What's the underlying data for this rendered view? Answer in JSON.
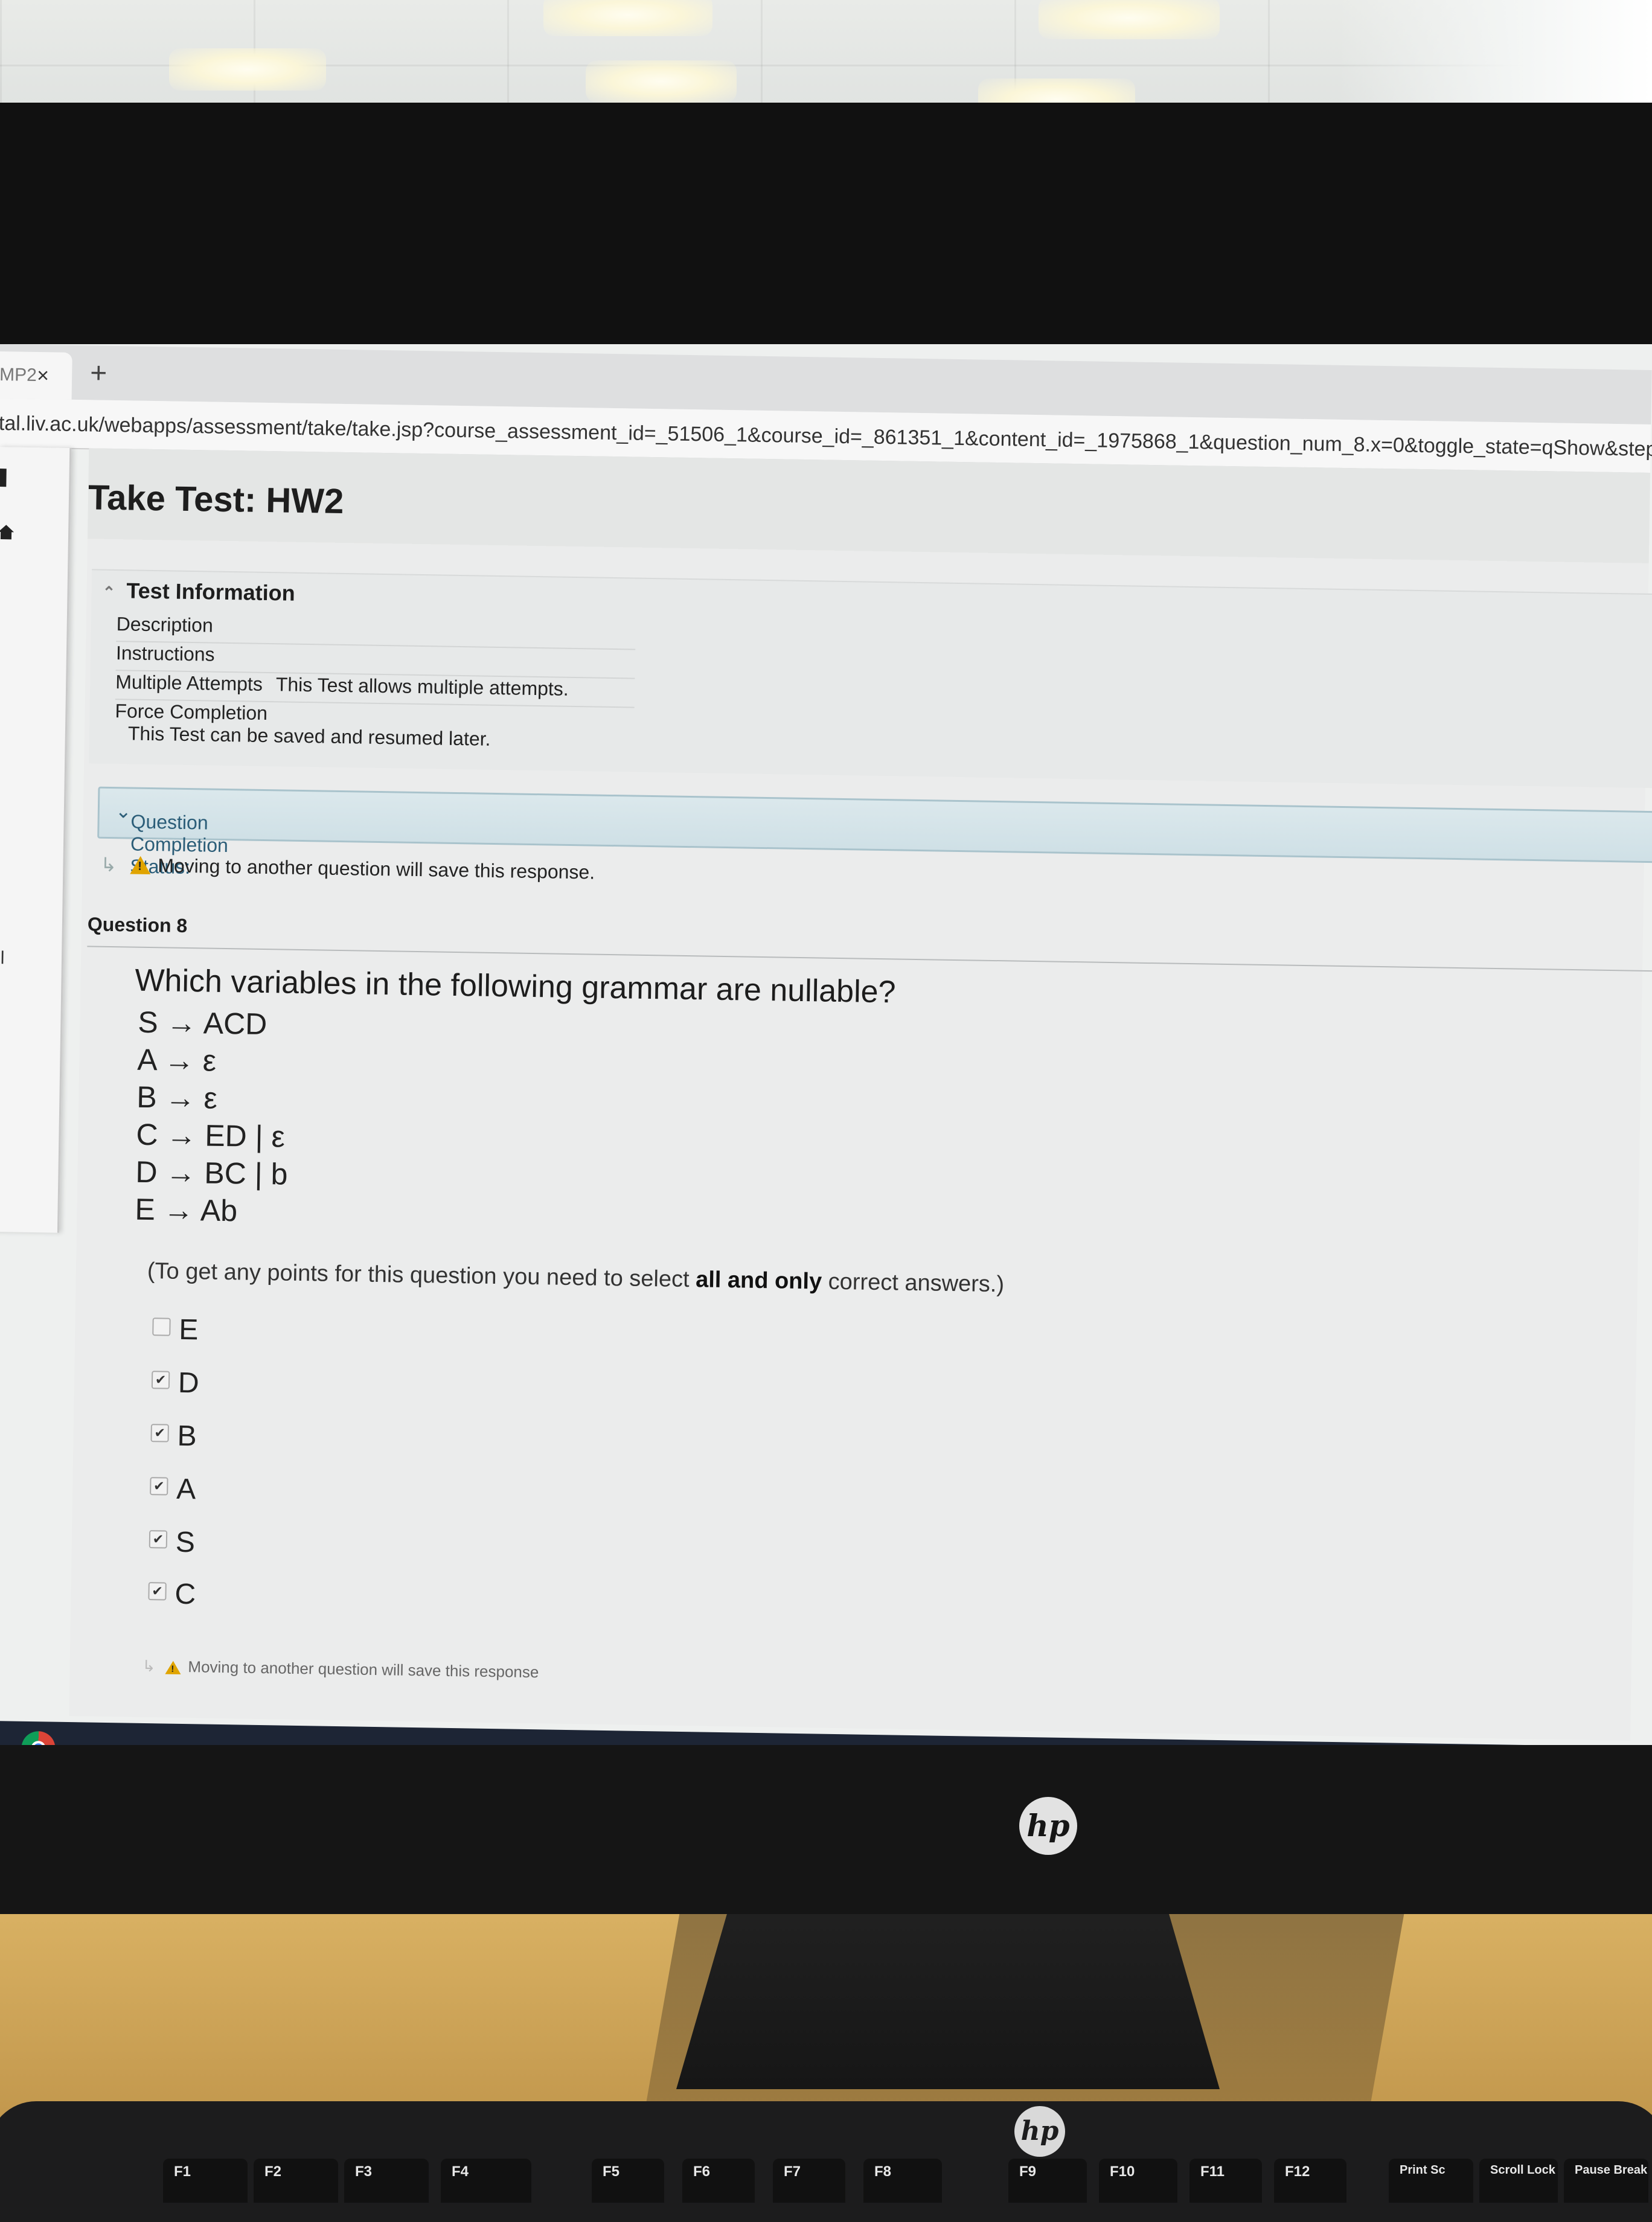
{
  "browser": {
    "tab_label": "MP2",
    "tab_close": "×",
    "new_tab": "+",
    "url": "tal.liv.ac.uk/webapps/assessment/take/take.jsp?course_assessment_id=_51506_1&course_id=_861351_1&content_id=_1975868_1&question_num_8.x=0&toggle_state=qShow&step=null"
  },
  "leftnav": {
    "partial_label": "ol"
  },
  "page": {
    "title": "Take Test: HW2"
  },
  "test_info": {
    "heading": "Test Information",
    "rows": [
      {
        "label": "Description",
        "value": ""
      },
      {
        "label": "Instructions",
        "value": ""
      },
      {
        "label": "Multiple Attempts",
        "value": "This Test allows multiple attempts."
      },
      {
        "label": "Force Completion",
        "value": "This Test can be saved and resumed later."
      }
    ]
  },
  "completion_status": {
    "label": "Question Completion Status:"
  },
  "warning": {
    "text": "Moving to another question will save this response."
  },
  "question": {
    "heading": "Question 8",
    "text": "Which variables in the following grammar are nullable?",
    "rules": [
      "S → ACD",
      "A → ε",
      "B → ε",
      "C → ED | ε",
      "D → BC | b",
      "E → Ab"
    ],
    "note_prefix": "(To get any points for this question you need to select ",
    "note_bold": "all and only",
    "note_suffix": " correct answers.)",
    "options": [
      {
        "label": "E",
        "checked": false
      },
      {
        "label": "D",
        "checked": true
      },
      {
        "label": "B",
        "checked": true
      },
      {
        "label": "A",
        "checked": true
      },
      {
        "label": "S",
        "checked": true
      },
      {
        "label": "C",
        "checked": true
      }
    ]
  },
  "bottom_warning": {
    "text": "Moving to another question will save this response"
  },
  "monitor": {
    "brand": "hp"
  },
  "keyboard": {
    "brand": "hp",
    "keys": [
      "F1",
      "F2",
      "F3",
      "F4",
      "F5",
      "F6",
      "F7",
      "F8",
      "F9",
      "F10",
      "F11",
      "F12",
      "Print Sc",
      "Scroll Lock",
      "Pause Break"
    ]
  },
  "colors": {
    "status_bar": "#cfe0e6",
    "status_text": "#2b5d78",
    "warning_icon": "#e0a400"
  }
}
